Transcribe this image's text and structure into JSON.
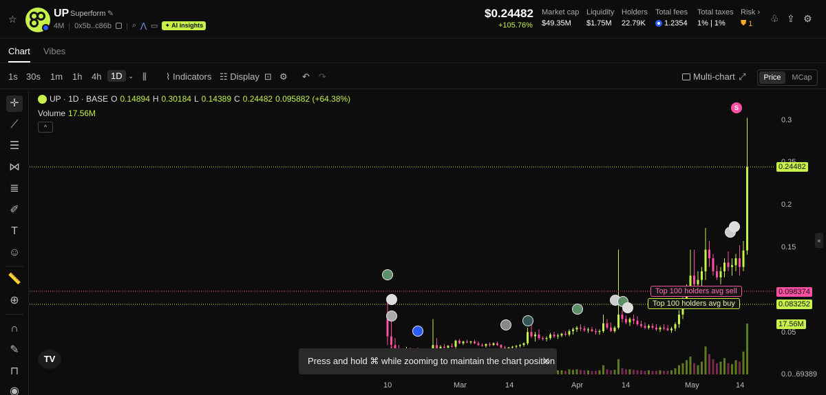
{
  "token": {
    "symbol": "UP",
    "name": "Superform",
    "age": "4M",
    "address": "0x5b..c86b",
    "ai_label": "AI insights"
  },
  "price": {
    "value": "$0.24482",
    "change": "+105.76%"
  },
  "stats": [
    {
      "label": "Market cap",
      "value": "$49.35M"
    },
    {
      "label": "Liquidity",
      "value": "$1.75M"
    },
    {
      "label": "Holders",
      "value": "22.79K"
    },
    {
      "label": "Total fees",
      "value": "1.2354"
    },
    {
      "label": "Total taxes",
      "value": "1% | 1%"
    },
    {
      "label": "Risk ›",
      "value": "1"
    }
  ],
  "tabs": [
    "Chart",
    "Vibes"
  ],
  "toolbar": {
    "intervals": [
      "1s",
      "30s",
      "1m",
      "1h",
      "4h",
      "1D"
    ],
    "indicators": "Indicators",
    "display": "Display",
    "multichart": "Multi-chart",
    "price": "Price",
    "mcap": "MCap"
  },
  "legend": {
    "title": "UP · 1D · BASE",
    "open": "0.14894",
    "high": "0.30184",
    "low": "0.14389",
    "close": "0.24482",
    "change": "0.095882 (+64.38%)",
    "volume_label": "Volume",
    "volume": "17.56M"
  },
  "toast": "Press and hold ⌘ while zooming to maintain the chart position",
  "tags": {
    "price": "0.24482",
    "sell": "0.098374",
    "buy": "0.083252",
    "volume": "17.56M"
  },
  "lines": {
    "sell_label": "Top 100 holders avg sell",
    "buy_label": "Top 100 holders avg buy"
  },
  "markers": {
    "sell_letter": "S"
  },
  "chart_data": {
    "type": "candlestick",
    "y_ticks": [
      "0.3",
      "0.25",
      "0.2",
      "0.15",
      "0.05",
      "0.0..69389"
    ],
    "x_ticks": [
      "10",
      "Mar",
      "14",
      "Apr",
      "14",
      "May",
      "14"
    ],
    "ylim": [
      0.0069389,
      0.31
    ],
    "price_lines": {
      "top100_avg_sell": 0.098374,
      "top100_avg_buy": 0.083252,
      "last": 0.24482
    },
    "candles": [
      [
        0.07,
        0.095,
        0.04,
        0.05
      ],
      [
        0.05,
        0.07,
        0.035,
        0.04
      ],
      [
        0.04,
        0.048,
        0.03,
        0.035
      ],
      [
        0.035,
        0.04,
        0.03,
        0.033
      ],
      [
        0.033,
        0.036,
        0.029,
        0.034
      ],
      [
        0.034,
        0.038,
        0.031,
        0.035
      ],
      [
        0.035,
        0.037,
        0.032,
        0.033
      ],
      [
        0.033,
        0.036,
        0.031,
        0.034
      ],
      [
        0.034,
        0.037,
        0.032,
        0.033
      ],
      [
        0.033,
        0.035,
        0.031,
        0.034
      ],
      [
        0.034,
        0.036,
        0.032,
        0.033
      ],
      [
        0.033,
        0.035,
        0.031,
        0.032
      ],
      [
        0.032,
        0.07,
        0.03,
        0.04
      ],
      [
        0.04,
        0.048,
        0.034,
        0.036
      ],
      [
        0.036,
        0.04,
        0.034,
        0.038
      ],
      [
        0.038,
        0.041,
        0.035,
        0.037
      ],
      [
        0.037,
        0.04,
        0.035,
        0.039
      ],
      [
        0.039,
        0.042,
        0.037,
        0.038
      ],
      [
        0.038,
        0.046,
        0.036,
        0.045
      ],
      [
        0.045,
        0.047,
        0.041,
        0.042
      ],
      [
        0.042,
        0.045,
        0.04,
        0.044
      ],
      [
        0.044,
        0.046,
        0.042,
        0.043
      ],
      [
        0.043,
        0.045,
        0.041,
        0.044
      ],
      [
        0.044,
        0.046,
        0.041,
        0.042
      ],
      [
        0.042,
        0.044,
        0.039,
        0.04
      ],
      [
        0.04,
        0.042,
        0.038,
        0.039
      ],
      [
        0.039,
        0.042,
        0.037,
        0.041
      ],
      [
        0.041,
        0.043,
        0.038,
        0.04
      ],
      [
        0.04,
        0.043,
        0.039,
        0.042
      ],
      [
        0.042,
        0.044,
        0.039,
        0.04
      ],
      [
        0.04,
        0.041,
        0.036,
        0.037
      ],
      [
        0.037,
        0.039,
        0.034,
        0.036
      ],
      [
        0.036,
        0.038,
        0.034,
        0.037
      ],
      [
        0.037,
        0.039,
        0.035,
        0.038
      ],
      [
        0.038,
        0.04,
        0.036,
        0.039
      ],
      [
        0.039,
        0.041,
        0.037,
        0.04
      ],
      [
        0.04,
        0.043,
        0.038,
        0.042
      ],
      [
        0.042,
        0.06,
        0.04,
        0.055
      ],
      [
        0.055,
        0.066,
        0.048,
        0.05
      ],
      [
        0.05,
        0.055,
        0.044,
        0.052
      ],
      [
        0.052,
        0.058,
        0.046,
        0.048
      ],
      [
        0.048,
        0.05,
        0.045,
        0.047
      ],
      [
        0.047,
        0.05,
        0.044,
        0.048
      ],
      [
        0.048,
        0.054,
        0.046,
        0.052
      ],
      [
        0.052,
        0.055,
        0.048,
        0.05
      ],
      [
        0.05,
        0.053,
        0.047,
        0.051
      ],
      [
        0.051,
        0.054,
        0.049,
        0.053
      ],
      [
        0.053,
        0.056,
        0.05,
        0.052
      ],
      [
        0.052,
        0.058,
        0.05,
        0.056
      ],
      [
        0.056,
        0.06,
        0.052,
        0.058
      ],
      [
        0.058,
        0.062,
        0.055,
        0.06
      ],
      [
        0.06,
        0.064,
        0.056,
        0.059
      ],
      [
        0.059,
        0.062,
        0.055,
        0.057
      ],
      [
        0.057,
        0.06,
        0.054,
        0.058
      ],
      [
        0.058,
        0.061,
        0.055,
        0.056
      ],
      [
        0.056,
        0.059,
        0.052,
        0.055
      ],
      [
        0.055,
        0.058,
        0.052,
        0.056
      ],
      [
        0.056,
        0.075,
        0.054,
        0.065
      ],
      [
        0.065,
        0.07,
        0.058,
        0.06
      ],
      [
        0.06,
        0.066,
        0.055,
        0.056
      ],
      [
        0.056,
        0.062,
        0.054,
        0.06
      ],
      [
        0.06,
        0.15,
        0.058,
        0.075
      ],
      [
        0.075,
        0.08,
        0.066,
        0.07
      ],
      [
        0.07,
        0.074,
        0.064,
        0.066
      ],
      [
        0.066,
        0.072,
        0.062,
        0.07
      ],
      [
        0.07,
        0.075,
        0.064,
        0.068
      ],
      [
        0.068,
        0.073,
        0.062,
        0.064
      ],
      [
        0.064,
        0.068,
        0.06,
        0.062
      ],
      [
        0.062,
        0.066,
        0.058,
        0.06
      ],
      [
        0.06,
        0.064,
        0.058,
        0.062
      ],
      [
        0.062,
        0.065,
        0.058,
        0.06
      ],
      [
        0.06,
        0.064,
        0.056,
        0.058
      ],
      [
        0.058,
        0.062,
        0.055,
        0.06
      ],
      [
        0.06,
        0.064,
        0.057,
        0.059
      ],
      [
        0.059,
        0.063,
        0.056,
        0.057
      ],
      [
        0.057,
        0.061,
        0.054,
        0.059
      ],
      [
        0.059,
        0.066,
        0.056,
        0.064
      ],
      [
        0.064,
        0.08,
        0.06,
        0.075
      ],
      [
        0.075,
        0.095,
        0.07,
        0.09
      ],
      [
        0.09,
        0.11,
        0.085,
        0.105
      ],
      [
        0.105,
        0.15,
        0.1,
        0.12
      ],
      [
        0.12,
        0.15,
        0.105,
        0.11
      ],
      [
        0.11,
        0.125,
        0.1,
        0.115
      ],
      [
        0.115,
        0.13,
        0.105,
        0.125
      ],
      [
        0.125,
        0.175,
        0.115,
        0.15
      ],
      [
        0.15,
        0.16,
        0.13,
        0.14
      ],
      [
        0.14,
        0.145,
        0.12,
        0.125
      ],
      [
        0.125,
        0.132,
        0.115,
        0.118
      ],
      [
        0.118,
        0.13,
        0.11,
        0.125
      ],
      [
        0.125,
        0.14,
        0.118,
        0.135
      ],
      [
        0.135,
        0.148,
        0.125,
        0.13
      ],
      [
        0.13,
        0.14,
        0.12,
        0.132
      ],
      [
        0.132,
        0.145,
        0.125,
        0.14
      ],
      [
        0.14,
        0.155,
        0.12,
        0.13
      ],
      [
        0.13,
        0.16,
        0.125,
        0.149
      ],
      [
        0.149,
        0.302,
        0.144,
        0.245
      ]
    ],
    "volumes": [
      0.3,
      0.55,
      0.22,
      0.12,
      0.1,
      0.08,
      0.07,
      0.06,
      0.07,
      0.06,
      0.06,
      0.05,
      0.35,
      0.18,
      0.1,
      0.09,
      0.08,
      0.07,
      0.12,
      0.08,
      0.07,
      0.06,
      0.06,
      0.07,
      0.06,
      0.05,
      0.06,
      0.05,
      0.06,
      0.05,
      0.05,
      0.05,
      0.05,
      0.05,
      0.06,
      0.06,
      0.08,
      0.22,
      0.12,
      0.09,
      0.08,
      0.07,
      0.07,
      0.09,
      0.07,
      0.08,
      0.08,
      0.07,
      0.1,
      0.09,
      0.1,
      0.09,
      0.08,
      0.08,
      0.07,
      0.07,
      0.08,
      0.18,
      0.1,
      0.08,
      0.09,
      0.3,
      0.12,
      0.1,
      0.1,
      0.09,
      0.08,
      0.08,
      0.07,
      0.08,
      0.07,
      0.07,
      0.08,
      0.07,
      0.07,
      0.08,
      0.12,
      0.18,
      0.22,
      0.28,
      0.35,
      0.22,
      0.18,
      0.25,
      0.55,
      0.4,
      0.3,
      0.22,
      0.25,
      0.32,
      0.22,
      0.2,
      0.28,
      0.25,
      0.45,
      1.0
    ]
  },
  "colors": {
    "accent": "#c6f04a",
    "up": "#c6f04a",
    "down": "#ff4fa3",
    "background": "#0d0d0d"
  }
}
